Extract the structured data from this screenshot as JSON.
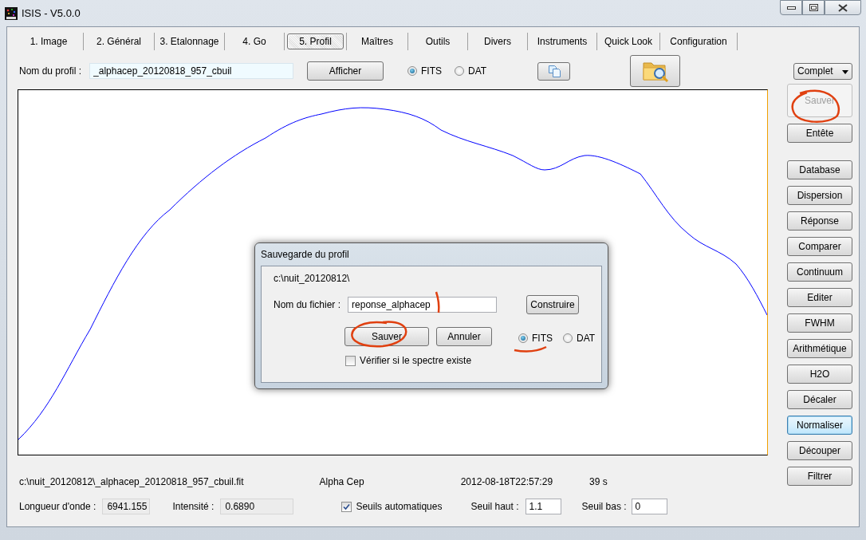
{
  "window": {
    "title": "ISIS - V5.0.0"
  },
  "tabs": [
    {
      "label": "1. Image",
      "selected": false
    },
    {
      "label": "2. Général",
      "selected": false
    },
    {
      "label": "3. Etalonnage",
      "selected": false
    },
    {
      "label": "4. Go",
      "selected": false
    },
    {
      "label": "5. Profil",
      "selected": true
    },
    {
      "label": "Maîtres",
      "selected": false
    },
    {
      "label": "Outils",
      "selected": false
    },
    {
      "label": "Divers",
      "selected": false
    },
    {
      "label": "Instruments",
      "selected": false
    },
    {
      "label": "Quick Look",
      "selected": false
    },
    {
      "label": "Configuration",
      "selected": false
    }
  ],
  "profile_bar": {
    "name_label": "Nom du profil :",
    "name_value": "_alphacep_20120818_957_cbuil",
    "display_button": "Afficher",
    "formats": [
      {
        "label": "FITS",
        "selected": true
      },
      {
        "label": "DAT",
        "selected": false
      }
    ],
    "view_select": "Complet"
  },
  "side_buttons": [
    {
      "label": "Sauver",
      "disabled": true,
      "focused": false
    },
    {
      "label": "Entête",
      "disabled": false,
      "focused": false
    },
    {
      "label": "Database",
      "disabled": false,
      "focused": false
    },
    {
      "label": "Dispersion",
      "disabled": false,
      "focused": false
    },
    {
      "label": "Réponse",
      "disabled": false,
      "focused": false
    },
    {
      "label": "Comparer",
      "disabled": false,
      "focused": false
    },
    {
      "label": "Continuum",
      "disabled": false,
      "focused": false
    },
    {
      "label": "Editer",
      "disabled": false,
      "focused": false
    },
    {
      "label": "FWHM",
      "disabled": false,
      "focused": false
    },
    {
      "label": "Arithmétique",
      "disabled": false,
      "focused": false
    },
    {
      "label": "H2O",
      "disabled": false,
      "focused": false
    },
    {
      "label": "Décaler",
      "disabled": false,
      "focused": false
    },
    {
      "label": "Normaliser",
      "disabled": false,
      "focused": true
    },
    {
      "label": "Découper",
      "disabled": false,
      "focused": false
    },
    {
      "label": "Filtrer",
      "disabled": false,
      "focused": false
    }
  ],
  "info": {
    "file": "c:\\nuit_20120812\\_alphacep_20120818_957_cbuil.fit",
    "object": "Alpha Cep",
    "date": "2012-08-18T22:57:29",
    "exposure": "39 s"
  },
  "readouts": {
    "wavelength_label": "Longueur d'onde :",
    "wavelength_value": "6941.155",
    "intensity_label": "Intensité :",
    "intensity_value": "0.6890",
    "auto_thresholds": {
      "label": "Seuils automatiques",
      "checked": true
    },
    "high_label": "Seuil haut :",
    "high_value": "1.1",
    "low_label": "Seuil bas :",
    "low_value": "0"
  },
  "dialog": {
    "title": "Sauvegarde du profil",
    "path": "c:\\nuit_20120812\\",
    "filename_label": "Nom du fichier :",
    "filename_value": "reponse_alphacep",
    "build_button": "Construire",
    "save_button": "Sauver",
    "cancel_button": "Annuler",
    "formats": [
      {
        "label": "FITS",
        "selected": true
      },
      {
        "label": "DAT",
        "selected": false
      }
    ],
    "check": {
      "label": "Vérifier si le spectre existe",
      "checked": false
    }
  }
}
